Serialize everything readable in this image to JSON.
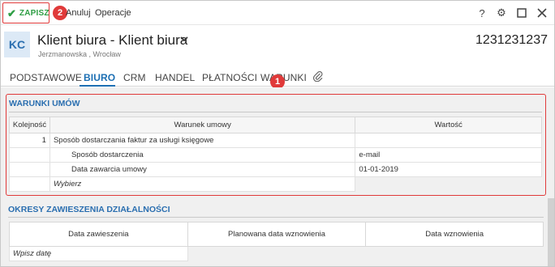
{
  "toolbar": {
    "save_label": "ZAPISZ",
    "cancel_label": "Anuluj",
    "operations_label": "Operacje",
    "badge_2": "2",
    "help_icon": "?",
    "settings_icon": "⚙",
    "maximize_icon": "☐",
    "close_icon": "✕"
  },
  "header": {
    "avatar": "KC",
    "title": "Klient biura - Klient biura",
    "subtitle": "Jerzmanowska , Wrocław",
    "number": "1231231237"
  },
  "tabs": [
    {
      "label": "PODSTAWOWE"
    },
    {
      "label": "BIURO",
      "active": true
    },
    {
      "label": "CRM"
    },
    {
      "label": "HANDEL"
    },
    {
      "label": "PŁATNOŚCI"
    },
    {
      "label": "WARUNKI"
    }
  ],
  "badge_1": "1",
  "warunki": {
    "title": "WARUNKI UMÓW",
    "columns": [
      "Kolejność",
      "Warunek umowy",
      "Wartość"
    ],
    "rows": [
      {
        "order": "1",
        "condition": "Sposób dostarczania faktur za usługi księgowe",
        "value": ""
      },
      {
        "order": "",
        "condition": "Sposób dostarczenia",
        "value": "e-mail"
      },
      {
        "order": "",
        "condition": "Data zawarcia umowy",
        "value": "01-01-2019"
      }
    ],
    "select_placeholder": "Wybierz"
  },
  "okresy": {
    "title": "OKRESY ZAWIESZENIA DZIAŁALNOŚCI",
    "columns": [
      "Data zawieszenia",
      "Planowana data wznowienia",
      "Data wznowienia"
    ],
    "date_placeholder": "Wpisz datę"
  }
}
